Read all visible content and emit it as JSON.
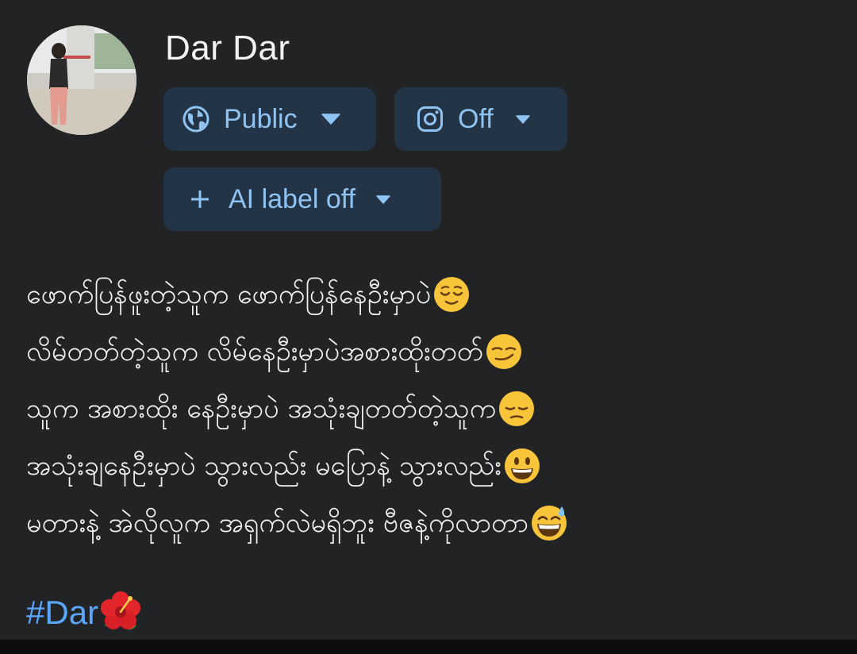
{
  "author": {
    "name": "Dar Dar"
  },
  "chips": {
    "audience_label": "Public",
    "instagram_label": "Off",
    "ai_label": "AI label off"
  },
  "post": {
    "lines": [
      {
        "text": "ဖောက်ပြန်ဖူးတဲ့သူက ဖောက်ပြန်နေဦးမှာပဲ",
        "emoji": "relieved-face"
      },
      {
        "text": "လိမ်တတ်တဲ့သူက လိမ်နေဦးမှာပဲအစားထိုးတတ်",
        "emoji": "smirking-face"
      },
      {
        "text": "သူက အစားထိုး နေဦးမှာပဲ အသုံးချတတ်တဲ့သူက ",
        "emoji": "pensive-face"
      },
      {
        "text": "အသုံးချနေဦးမှာပဲ သွားလည်း မပြောနဲ့ သွားလည်း ",
        "emoji": "grinning-face"
      },
      {
        "text": "မတားနဲ့ အဲလိုလူက အရှက်လဲမရှိဘူး ဗီဇနဲ့ကိုလာတာ",
        "emoji": "grinning-face-with-sweat"
      }
    ],
    "hashtag": "#Dar",
    "hashtag_emoji": "hibiscus"
  },
  "colors": {
    "background": "#222325",
    "chip_background": "#243447",
    "chip_text": "#8fc3f2",
    "hashtag": "#5aa7ff",
    "text": "#f1f2f4"
  }
}
